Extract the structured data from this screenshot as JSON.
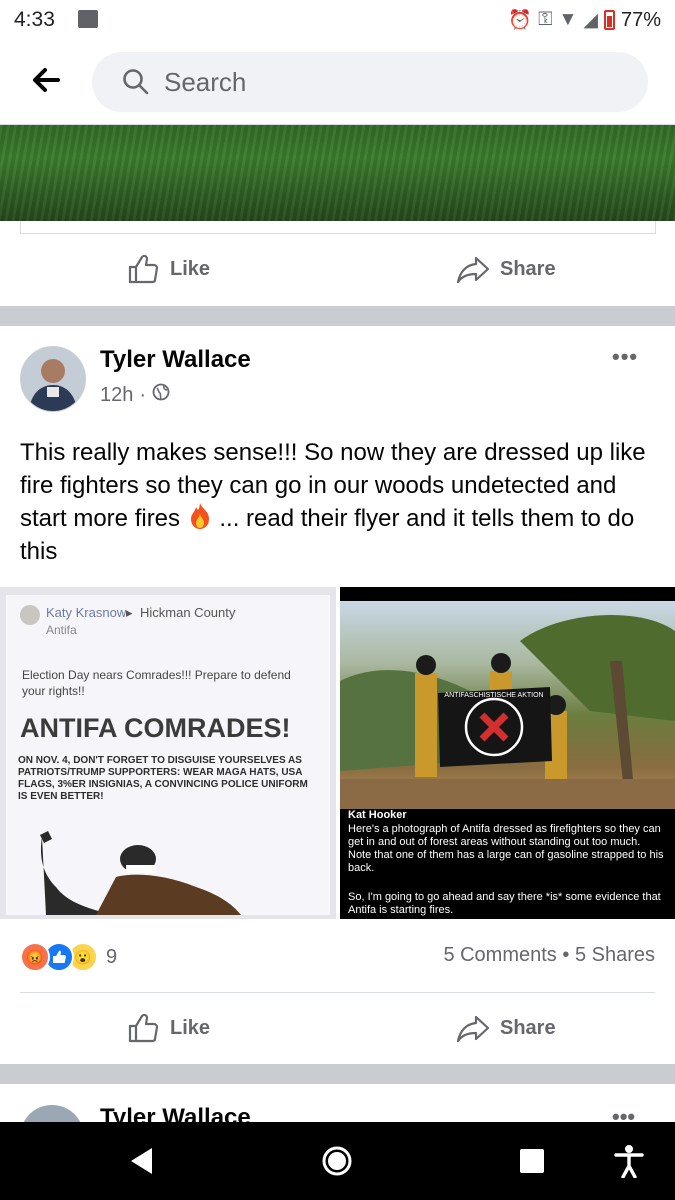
{
  "status_bar": {
    "time": "4:33",
    "battery": "77%"
  },
  "top_bar": {
    "search_placeholder": "Search"
  },
  "post1": {
    "like_label": "Like",
    "share_label": "Share"
  },
  "post2": {
    "author": "Tyler Wallace",
    "timestamp": "12h",
    "text": "This really makes sense!!! So now they are dressed up like fire fighters so they can go in our woods undetected and start more fires",
    "text_after_emoji": " ... read their flyer and it tells them to do this",
    "image_left": {
      "poster_author": "Katy Krasnow",
      "poster_group": "Hickman County",
      "poster_group2": "Antifa",
      "poster_line1": "Election Day nears Comrades!!! Prepare to defend your rights!!",
      "poster_headline": "ANTIFA COMRADES!",
      "poster_body": "ON NOV. 4, DON'T FORGET TO DISGUISE YOURSELVES AS PATRIOTS/TRUMP SUPPORTERS: WEAR MAGA HATS, USA FLAGS, 3%ER INSIGNIAS, A CONVINCING POLICE UNIFORM IS EVEN BETTER!"
    },
    "image_right": {
      "flag_text": "ANTIFASCHISTISCHE AKTION",
      "caption_author": "Kat Hooker",
      "caption_text": "Here's a photograph of Antifa dressed as firefighters so they can get in and out of forest areas without standing out too much. Note that one of them has a large can of gasoline strapped to his back.",
      "caption_text2": "So, I'm going to go ahead and say there *is* some evidence that Antifa is starting fires."
    },
    "reaction_count": "9",
    "comments": "5 Comments",
    "shares": "5 Shares",
    "like_label": "Like",
    "share_label": "Share"
  },
  "post3": {
    "author": "Tyler Wallace"
  }
}
